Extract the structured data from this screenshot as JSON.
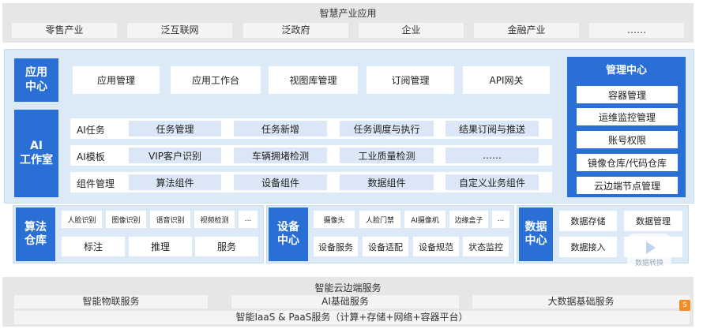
{
  "top": {
    "title": "智慧产业应用",
    "items": [
      "零售产业",
      "泛互联网",
      "泛政府",
      "企业",
      "金融产业",
      "……"
    ]
  },
  "app_center": {
    "label": "应用\n中心",
    "items": [
      "应用管理",
      "应用工作台",
      "视图库管理",
      "订阅管理",
      "API网关"
    ]
  },
  "ai_studio": {
    "label": "AI\n工作室",
    "rows": [
      {
        "label": "AI任务",
        "items": [
          "任务管理",
          "任务新增",
          "任务调度与执行",
          "结果订阅与推送"
        ]
      },
      {
        "label": "AI模板",
        "items": [
          "VIP客户识别",
          "车辆拥堵检测",
          "工业质量检测",
          "……"
        ]
      },
      {
        "label": "组件管理",
        "items": [
          "算法组件",
          "设备组件",
          "数据组件",
          "自定义业务组件"
        ]
      }
    ]
  },
  "mgmt_center": {
    "title": "管理中心",
    "items": [
      "容器管理",
      "运维监控管理",
      "账号权限",
      "镜像仓库/代码仓库",
      "云边端节点管理"
    ]
  },
  "algo_repo": {
    "label": "算法\n仓库",
    "top_items": [
      "人脸识别",
      "图像识别",
      "语音识别",
      "视频检测",
      "..."
    ],
    "bottom_items": [
      "标注",
      "推理",
      "服务"
    ]
  },
  "device_center": {
    "label": "设备\n中心",
    "top_items": [
      "摄像头",
      "人脸门禁",
      "AI摄像机",
      "边缘盒子",
      "..."
    ],
    "bottom_items": [
      "设备服务",
      "设备适配",
      "设备规范",
      "状态监控"
    ]
  },
  "data_center": {
    "label": "数据\n中心",
    "items": [
      "数据存储",
      "数据管理",
      "数据接入",
      ""
    ]
  },
  "bottom": {
    "title": "智能云边端服务",
    "items": [
      "智能物联服务",
      "AI基础服务",
      "大数据基础服务"
    ],
    "footer": "智能IaaS & PaaS服务（计算+存储+网络+容器平台）"
  },
  "overlay": {
    "watermark_text": "数据转换",
    "corner_badge": "S"
  },
  "colors": {
    "accent": "#2a6fd6",
    "panel": "#dce9f7",
    "grey": "#e6e6e6"
  }
}
